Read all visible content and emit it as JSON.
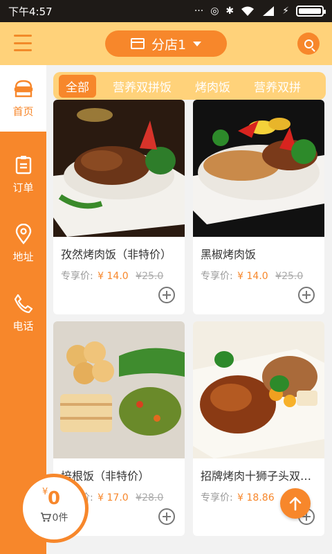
{
  "status_bar": {
    "time": "下午4:57"
  },
  "header": {
    "store_name": "分店1"
  },
  "sidebar": {
    "items": [
      {
        "label": "首页",
        "icon": "home-icon"
      },
      {
        "label": "订单",
        "icon": "clipboard-icon"
      },
      {
        "label": "地址",
        "icon": "location-pin-icon"
      },
      {
        "label": "电话",
        "icon": "phone-icon"
      }
    ]
  },
  "tabs": [
    "全部",
    "营养双拼饭",
    "烤肉饭",
    "营养双拼"
  ],
  "products": [
    {
      "name": "孜然烤肉饭（非特价）",
      "price_label": "专享价:",
      "price": "¥ 14.0",
      "old_price": "¥25.0"
    },
    {
      "name": "黑椒烤肉饭",
      "price_label": "专享价:",
      "price": "¥ 14.0",
      "old_price": "¥25.0"
    },
    {
      "name": "培根饭（非特价）",
      "price_label": "专享价:",
      "price": "¥ 17.0",
      "old_price": "¥28.0"
    },
    {
      "name": "招牌烤肉十狮子头双拼饭",
      "price_label": "专享价:",
      "price": "¥ 18.86",
      "old_price": ""
    }
  ],
  "cart": {
    "currency": "¥",
    "amount": "0",
    "count": "0件"
  },
  "colors": {
    "accent": "#f7872b",
    "header": "#ffd27a"
  }
}
